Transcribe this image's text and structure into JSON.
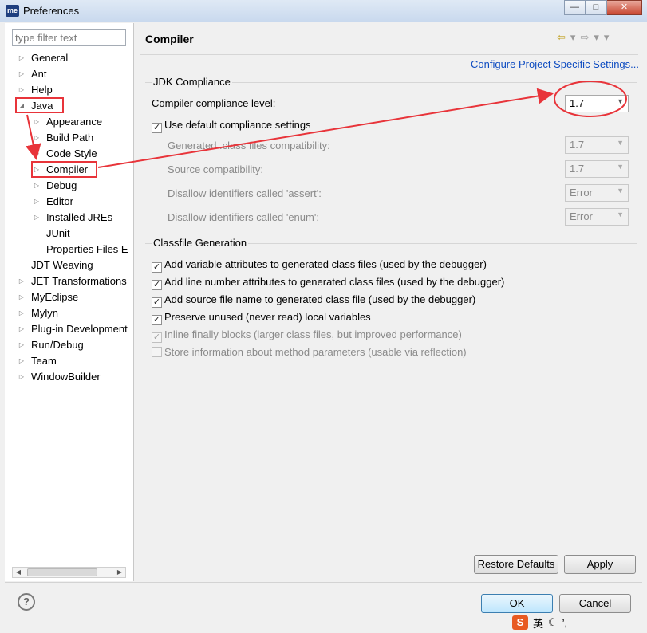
{
  "window": {
    "title": "Preferences",
    "app_icon_text": "me",
    "buttons": [
      "minimize",
      "maximize",
      "close"
    ]
  },
  "filter": {
    "placeholder": "type filter text",
    "value": ""
  },
  "tree": [
    {
      "label": "General",
      "expanded": false,
      "level": 0
    },
    {
      "label": "Ant",
      "expanded": false,
      "level": 0
    },
    {
      "label": "Help",
      "expanded": false,
      "level": 0
    },
    {
      "label": "Java",
      "expanded": true,
      "level": 0
    },
    {
      "label": "Appearance",
      "expanded": false,
      "level": 1
    },
    {
      "label": "Build Path",
      "expanded": false,
      "level": 1
    },
    {
      "label": "Code Style",
      "expanded": false,
      "level": 1
    },
    {
      "label": "Compiler",
      "expanded": false,
      "level": 1,
      "selected": true
    },
    {
      "label": "Debug",
      "expanded": false,
      "level": 1
    },
    {
      "label": "Editor",
      "expanded": false,
      "level": 1
    },
    {
      "label": "Installed JREs",
      "expanded": false,
      "level": 1
    },
    {
      "label": "JUnit",
      "leaf": true,
      "level": 1
    },
    {
      "label": "Properties Files E",
      "leaf": true,
      "level": 1
    },
    {
      "label": "JDT Weaving",
      "leaf": true,
      "level": 0
    },
    {
      "label": "JET Transformations",
      "expanded": false,
      "level": 0
    },
    {
      "label": "MyEclipse",
      "expanded": false,
      "level": 0
    },
    {
      "label": "Mylyn",
      "expanded": false,
      "level": 0
    },
    {
      "label": "Plug-in Development",
      "expanded": false,
      "level": 0
    },
    {
      "label": "Run/Debug",
      "expanded": false,
      "level": 0
    },
    {
      "label": "Team",
      "expanded": false,
      "level": 0
    },
    {
      "label": "WindowBuilder",
      "expanded": false,
      "level": 0
    }
  ],
  "page": {
    "title": "Compiler",
    "config_link": "Configure Project Specific Settings...",
    "jdk": {
      "group_title": "JDK Compliance",
      "compliance_label": "Compiler compliance level:",
      "compliance_value": "1.7",
      "use_default": {
        "label": "Use default compliance settings",
        "checked": true
      },
      "generated_label": "Generated .class files compatibility:",
      "generated_value": "1.7",
      "source_label": "Source compatibility:",
      "source_value": "1.7",
      "assert_label": "Disallow identifiers called 'assert':",
      "assert_value": "Error",
      "enum_label": "Disallow identifiers called 'enum':",
      "enum_value": "Error"
    },
    "classfile": {
      "group_title": "Classfile Generation",
      "options": [
        {
          "label": "Add variable attributes to generated class files (used by the debugger)",
          "checked": true,
          "enabled": true
        },
        {
          "label": "Add line number attributes to generated class files (used by the debugger)",
          "checked": true,
          "enabled": true
        },
        {
          "label": "Add source file name to generated class file (used by the debugger)",
          "checked": true,
          "enabled": true
        },
        {
          "label": "Preserve unused (never read) local variables",
          "checked": true,
          "enabled": true
        },
        {
          "label": "Inline finally blocks (larger class files, but improved performance)",
          "checked": true,
          "enabled": false
        },
        {
          "label": "Store information about method parameters (usable via reflection)",
          "checked": false,
          "enabled": false
        }
      ]
    }
  },
  "buttons": {
    "restore": "Restore Defaults",
    "apply": "Apply",
    "ok": "OK",
    "cancel": "Cancel"
  },
  "ime": {
    "logo": "S",
    "mode": "英"
  },
  "colors": {
    "link": "#0e4cc1",
    "annotation": "#e8343a",
    "accent_ok": "#3c7fb1"
  }
}
